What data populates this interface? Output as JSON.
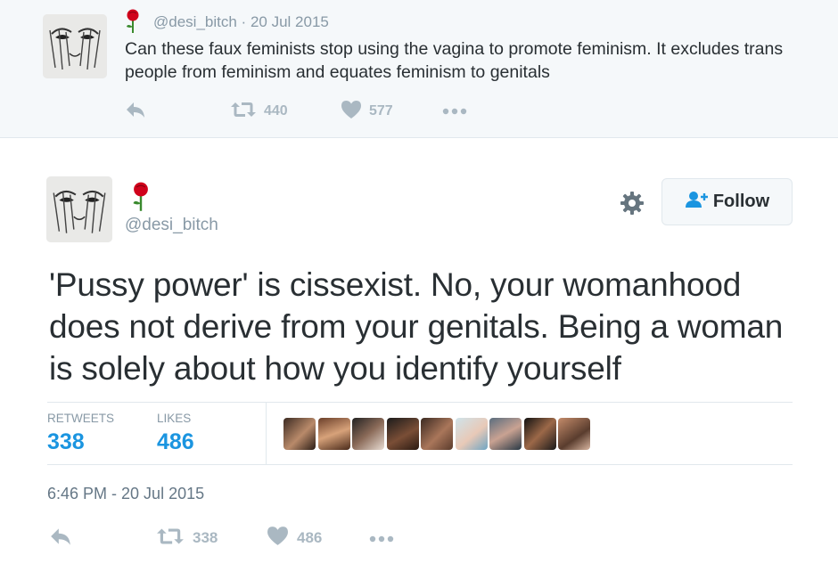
{
  "context_tweet": {
    "avatar_icon": "sketch-face-avatar",
    "rose_icon": "rose-emoji",
    "handle": "@desi_bitch",
    "separator": "·",
    "date": "20 Jul 2015",
    "text": "Can these faux feminists stop using the vagina to promote feminism. It excludes trans people from feminism and equates feminism to genitals",
    "actions": {
      "reply_icon": "reply-icon",
      "retweet_icon": "retweet-icon",
      "retweet_count": "440",
      "like_icon": "heart-icon",
      "like_count": "577",
      "more_icon": "more-icon"
    }
  },
  "main_tweet": {
    "avatar_icon": "sketch-face-avatar",
    "rose_icon": "rose-emoji",
    "handle": "@desi_bitch",
    "settings_icon": "gear-icon",
    "follow_label": "Follow",
    "follow_icon": "add-user-icon",
    "text": "'Pussy power' is cissexist. No, your womanhood does not derive from your genitals. Being a woman is solely about how you identify yourself",
    "stats": {
      "retweets_label": "RETWEETS",
      "retweets_value": "338",
      "likes_label": "LIKES",
      "likes_value": "486"
    },
    "likers_count_shown": 9,
    "timestamp": "6:46 PM - 20 Jul 2015",
    "actions": {
      "reply_icon": "reply-icon",
      "retweet_icon": "retweet-icon",
      "retweet_count": "338",
      "like_icon": "heart-icon",
      "like_count": "486",
      "more_icon": "more-icon"
    }
  },
  "colors": {
    "link_blue": "#1b95e0",
    "muted_gray": "#8899a6",
    "icon_gray": "#aab8c2",
    "text_dark": "#292f33",
    "context_bg": "#f5f8fa",
    "rose_red": "#d0021b"
  }
}
